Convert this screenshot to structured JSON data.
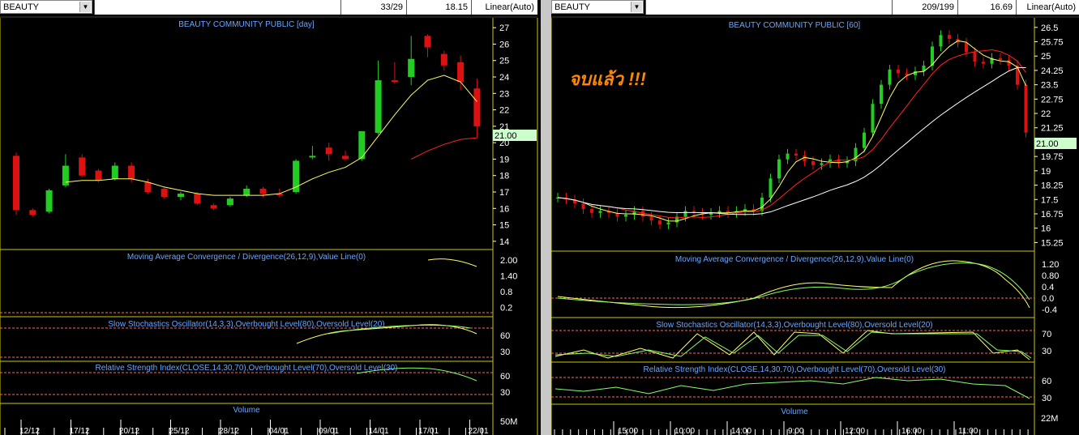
{
  "left": {
    "symbol": "BEAUTY",
    "counter": "33/29",
    "last_price": "18.15",
    "scale_mode": "Linear(Auto)",
    "title": "BEAUTY COMMUNITY PUBLIC [day]",
    "price_tag": "21.00",
    "macd_title": "Moving Average Convergence / Divergence(26,12,9),Value Line(0)",
    "stoch_title": "Slow Stochastics Oscillator(14,3,3),Overbought Level(80),Oversold Level(20)",
    "rsi_title": "Relative Strength Index(CLOSE,14,30,70),Overbought Level(70),Oversold Level(30)",
    "volume_title": "Volume",
    "volume_tick": "50M"
  },
  "right": {
    "symbol": "BEAUTY",
    "counter": "209/199",
    "last_price": "16.69",
    "scale_mode": "Linear(Auto)",
    "title": "BEAUTY COMMUNITY PUBLIC [60]",
    "price_tag": "21.00",
    "annotation": "จบแล้ว !!!",
    "macd_title": "Moving Average Convergence / Divergence(26,12,9),Value Line(0)",
    "stoch_title": "Slow Stochastics Oscillator(14,3,3),Overbought Level(80),Oversold Level(20)",
    "rsi_title": "Relative Strength Index(CLOSE,14,30,70),Overbought Level(70),Oversold Level(30)",
    "volume_title": "Volume",
    "volume_tick": "22M"
  },
  "colors": {
    "up": "#22cc22",
    "down": "#dd1111",
    "ma_fast": "#ffff66",
    "ma_slow": "#ff2222",
    "ma_long": "#ffffff",
    "label": "#6aa6ff",
    "border": "#c8c800",
    "tag": "#ccffcc",
    "annotation": "#ff8800"
  },
  "chart_data": [
    {
      "type": "candlestick",
      "title": "BEAUTY COMMUNITY PUBLIC [day]",
      "x_tick_labels": [
        "12/12",
        "17/12",
        "20/12",
        "25/12",
        "28/12",
        "04/01",
        "09/01",
        "14/01",
        "17/01",
        "22/01"
      ],
      "y_ticks": [
        14,
        15,
        16,
        17,
        18,
        19,
        20,
        21,
        22,
        23,
        24,
        25,
        26,
        27
      ],
      "ylim": [
        13.5,
        27.6
      ],
      "candles": [
        {
          "o": 19.2,
          "h": 19.4,
          "l": 15.6,
          "c": 15.9
        },
        {
          "o": 15.9,
          "h": 16.0,
          "l": 15.5,
          "c": 15.6
        },
        {
          "o": 15.8,
          "h": 17.2,
          "l": 15.7,
          "c": 17.1
        },
        {
          "o": 17.4,
          "h": 19.3,
          "l": 17.3,
          "c": 18.6
        },
        {
          "o": 19.1,
          "h": 19.3,
          "l": 17.9,
          "c": 18.0
        },
        {
          "o": 18.3,
          "h": 18.4,
          "l": 17.6,
          "c": 17.7
        },
        {
          "o": 17.8,
          "h": 18.8,
          "l": 17.7,
          "c": 18.6
        },
        {
          "o": 18.6,
          "h": 18.8,
          "l": 17.6,
          "c": 17.8
        },
        {
          "o": 17.6,
          "h": 17.8,
          "l": 16.9,
          "c": 17.0
        },
        {
          "o": 17.2,
          "h": 17.3,
          "l": 16.6,
          "c": 16.7
        },
        {
          "o": 16.7,
          "h": 17.0,
          "l": 16.5,
          "c": 16.9
        },
        {
          "o": 16.9,
          "h": 17.0,
          "l": 16.2,
          "c": 16.3
        },
        {
          "o": 16.2,
          "h": 16.3,
          "l": 15.9,
          "c": 16.0
        },
        {
          "o": 16.2,
          "h": 16.7,
          "l": 16.1,
          "c": 16.6
        },
        {
          "o": 16.8,
          "h": 17.4,
          "l": 16.7,
          "c": 17.2
        },
        {
          "o": 17.2,
          "h": 17.3,
          "l": 16.7,
          "c": 16.9
        },
        {
          "o": 16.9,
          "h": 17.2,
          "l": 16.7,
          "c": 16.8
        },
        {
          "o": 17.0,
          "h": 19.0,
          "l": 16.9,
          "c": 18.9
        },
        {
          "o": 19.1,
          "h": 19.8,
          "l": 19.0,
          "c": 19.2
        },
        {
          "o": 19.7,
          "h": 20.0,
          "l": 18.9,
          "c": 19.3
        },
        {
          "o": 19.2,
          "h": 19.5,
          "l": 18.9,
          "c": 19.0
        },
        {
          "o": 19.0,
          "h": 20.7,
          "l": 18.9,
          "c": 20.7
        },
        {
          "o": 20.6,
          "h": 25.0,
          "l": 20.5,
          "c": 23.8
        },
        {
          "o": 23.8,
          "h": 24.9,
          "l": 23.6,
          "c": 23.7
        },
        {
          "o": 24.0,
          "h": 26.5,
          "l": 23.5,
          "c": 25.1
        },
        {
          "o": 26.5,
          "h": 26.6,
          "l": 25.2,
          "c": 25.8
        },
        {
          "o": 25.4,
          "h": 25.6,
          "l": 24.4,
          "c": 24.7
        },
        {
          "o": 24.9,
          "h": 25.3,
          "l": 23.2,
          "c": 23.7
        },
        {
          "o": 23.3,
          "h": 23.9,
          "l": 20.3,
          "c": 21.0
        }
      ],
      "ma_fast": [
        null,
        null,
        null,
        17.6,
        17.7,
        17.7,
        17.8,
        17.8,
        17.6,
        17.3,
        17.1,
        16.9,
        16.8,
        16.8,
        16.8,
        16.8,
        16.9,
        17.3,
        17.8,
        18.2,
        18.5,
        19.1,
        20.4,
        21.7,
        22.9,
        23.8,
        24.1,
        23.7,
        22.5
      ],
      "ma_slow": [
        null,
        null,
        null,
        null,
        null,
        null,
        null,
        null,
        null,
        null,
        null,
        null,
        null,
        null,
        null,
        null,
        null,
        null,
        null,
        null,
        null,
        null,
        null,
        null,
        19.0,
        19.5,
        19.9,
        20.2,
        20.3
      ],
      "macd": [
        2.0,
        1.7
      ],
      "stochastic": [
        [
          60,
          64,
          67,
          70,
          72,
          74,
          76,
          78,
          79,
          80,
          78,
          60
        ],
        [
          68,
          70,
          72,
          73,
          75,
          77,
          78,
          80,
          80,
          79,
          77,
          72
        ]
      ],
      "rsi": [
        58,
        60,
        62,
        63,
        64,
        66,
        68,
        67,
        66,
        62,
        58,
        54
      ],
      "macd_ticks": [
        2.0,
        1.4,
        0.8,
        0.2
      ],
      "stoch_ticks": [
        60,
        30
      ],
      "rsi_ticks": [
        60,
        30
      ]
    },
    {
      "type": "candlestick",
      "title": "BEAUTY COMMUNITY PUBLIC [60]",
      "x_tick_labels": [
        "15:00",
        "10:00",
        "14:00",
        "9:00",
        "12:00",
        "16:00",
        "11:00"
      ],
      "y_ticks": [
        15.25,
        16,
        16.75,
        17.5,
        18.25,
        19,
        19.75,
        20.5,
        21.25,
        22,
        22.75,
        23.5,
        24.25,
        25,
        25.75,
        26.5
      ],
      "ylim": [
        14.8,
        27.0
      ],
      "macd_ticks": [
        1.2,
        0.8,
        0.4,
        0.0,
        -0.4
      ],
      "stoch_ticks": [
        70,
        30
      ],
      "rsi_ticks": [
        60,
        30
      ]
    }
  ]
}
